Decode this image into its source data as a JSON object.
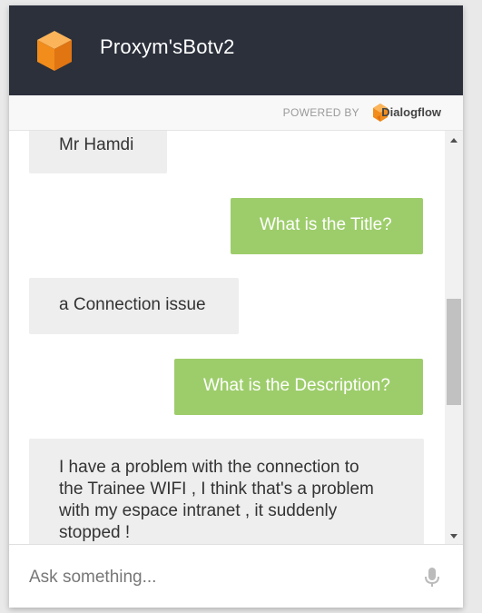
{
  "header": {
    "title": "Proxym'sBotv2"
  },
  "powered": {
    "label": "POWERED BY",
    "brand": "Dialogflow"
  },
  "messages": [
    {
      "from": "bot",
      "text": "Mr Hamdi"
    },
    {
      "from": "user",
      "text": "What is the Title?"
    },
    {
      "from": "bot",
      "text": "a Connection issue"
    },
    {
      "from": "user",
      "text": "What is the Description?"
    },
    {
      "from": "bot",
      "text": "I have a problem with the connection to the Trainee WIFI , I think that's a problem with my espace intranet , it suddenly stopped !"
    }
  ],
  "input": {
    "placeholder": "Ask something..."
  },
  "icons": {
    "logo": "cube-logo-icon",
    "brand": "dialogflow-logo-icon",
    "mic": "microphone-icon"
  },
  "colors": {
    "header_bg": "#2b303b",
    "user_bubble": "#9dcd6b",
    "bot_bubble": "#eeeeee",
    "brand_orange": "#f28c1b"
  }
}
